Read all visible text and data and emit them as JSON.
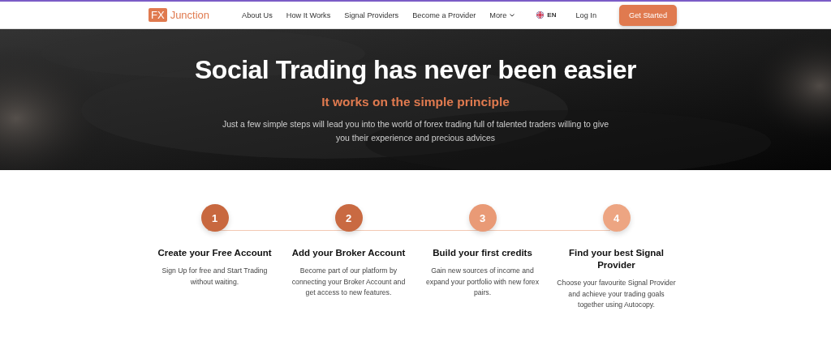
{
  "logo": {
    "badge": "FX",
    "name": "Junction"
  },
  "nav": [
    {
      "label": "About Us",
      "dropdown": false
    },
    {
      "label": "How It Works",
      "dropdown": false
    },
    {
      "label": "Signal Providers",
      "dropdown": false
    },
    {
      "label": "Become a Provider",
      "dropdown": false
    },
    {
      "label": "More",
      "dropdown": true
    }
  ],
  "language": "EN",
  "login": "Log In",
  "cta": "Get Started",
  "hero": {
    "title": "Social Trading has never been easier",
    "subtitle": "It works on the simple principle",
    "text": "Just a few simple steps will lead you into the world of forex trading full of talented traders willing to give you their experience and precious advices"
  },
  "steps": [
    {
      "number": "1",
      "color": "#c8683f",
      "title": "Create your Free Account",
      "text": "Sign Up for free and Start Trading without waiting."
    },
    {
      "number": "2",
      "color": "#c96a42",
      "title": "Add your Broker Account",
      "text": "Become part of our platform by connecting your Broker Account and get access to new features."
    },
    {
      "number": "3",
      "color": "#e99a76",
      "title": "Build your first credits",
      "text": "Gain new sources of income and expand your portfolio with new forex pairs."
    },
    {
      "number": "4",
      "color": "#eda582",
      "title": "Find your best Signal Provider",
      "text": "Choose your favourite Signal Provider and achieve your trading goals together using Autocopy."
    }
  ]
}
